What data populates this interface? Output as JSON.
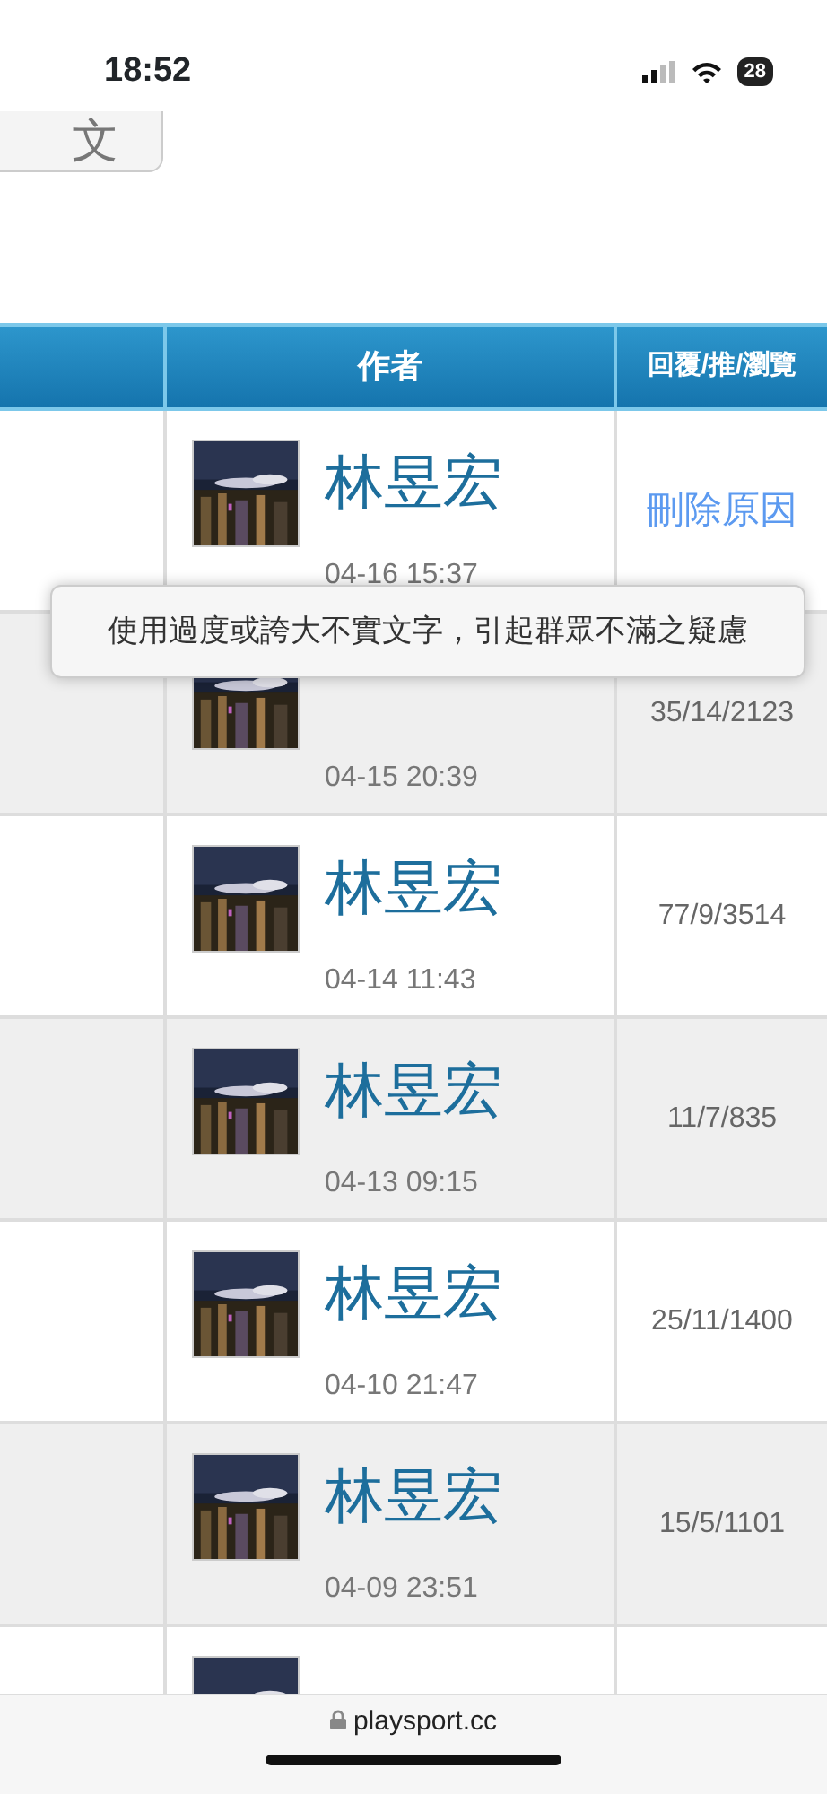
{
  "status_bar": {
    "time": "18:52",
    "battery": "28"
  },
  "top_button": {
    "label": "文"
  },
  "table": {
    "columns": [
      "",
      "作者",
      "回覆/推/瀏覽"
    ],
    "rows": [
      {
        "author": "林昱宏",
        "date": "04-16 15:37",
        "stats": "刪除原因",
        "kind": "deleted"
      },
      {
        "date": "04-15 20:39",
        "stats": "35/14/2123",
        "kind": "normal"
      },
      {
        "author": "林昱宏",
        "date": "04-14 11:43",
        "stats": "77/9/3514",
        "kind": "normal"
      },
      {
        "author": "林昱宏",
        "date": "04-13 09:15",
        "stats": "11/7/835",
        "kind": "normal"
      },
      {
        "author": "林昱宏",
        "date": "04-10 21:47",
        "stats": "25/11/1400",
        "kind": "normal"
      },
      {
        "author": "林昱宏",
        "date": "04-09 23:51",
        "stats": "15/5/1101",
        "kind": "normal"
      }
    ]
  },
  "tooltip": {
    "text": "使用過度或誇大不實文字，引起群眾不滿之疑慮"
  },
  "browser_bar": {
    "url": "playsport.cc"
  }
}
